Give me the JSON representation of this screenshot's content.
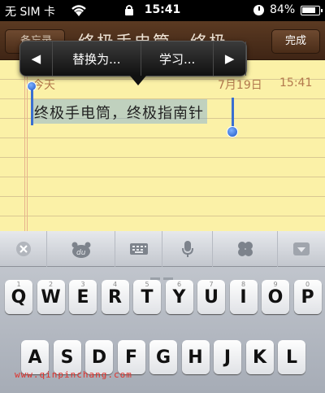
{
  "status_bar": {
    "carrier": "无 SIM 卡",
    "time": "15:41",
    "battery": "84%",
    "battery_fraction": 0.84
  },
  "nav_bar": {
    "back_label": "备忘录",
    "title": "终极手电筒，终极...",
    "done_label": "完成"
  },
  "edit_menu": {
    "prev_label": "◀",
    "replace_label": "替换为...",
    "learn_label": "学习...",
    "next_label": "▶"
  },
  "note": {
    "day": "今天",
    "date": "7月19日",
    "time": "15:41",
    "text": "终极手电筒，终极指南针"
  },
  "keyboard": {
    "row1": [
      {
        "letter": "Q",
        "num": "1"
      },
      {
        "letter": "W",
        "num": "2"
      },
      {
        "letter": "E",
        "num": "3"
      },
      {
        "letter": "R",
        "num": "4"
      },
      {
        "letter": "T",
        "num": "5"
      },
      {
        "letter": "Y",
        "num": "6"
      },
      {
        "letter": "U",
        "num": "7"
      },
      {
        "letter": "I",
        "num": "8"
      },
      {
        "letter": "O",
        "num": "9"
      },
      {
        "letter": "P",
        "num": "0"
      }
    ],
    "row2": [
      "A",
      "S",
      "D",
      "F",
      "G",
      "H",
      "J",
      "K",
      "L"
    ]
  },
  "watermark": "www.qinpinchang.com"
}
